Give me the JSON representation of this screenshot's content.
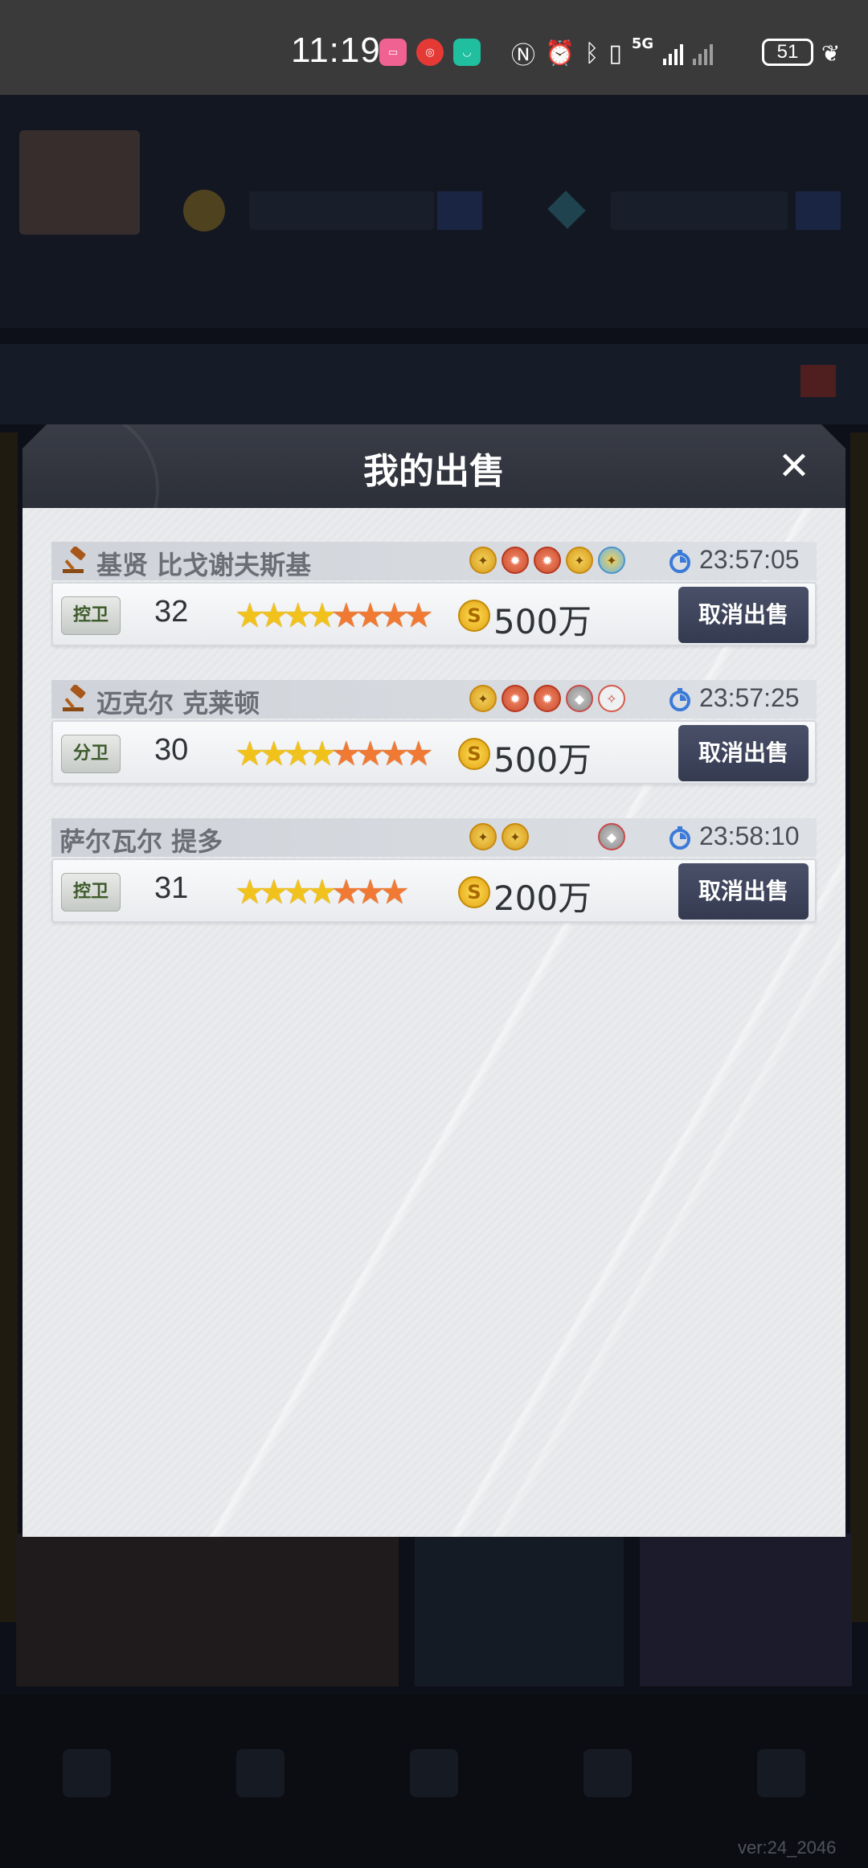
{
  "status_bar": {
    "time": "11:19",
    "battery": "51",
    "network": "5G",
    "icons": [
      "bilibili-icon",
      "app-red-icon",
      "app-green-icon",
      "nfc-icon",
      "alarm-icon",
      "bluetooth-icon",
      "vibrate-icon",
      "signal-icon",
      "battery-icon",
      "leaf-icon"
    ]
  },
  "modal": {
    "title": "我的出售",
    "close_icon": "close-icon"
  },
  "listings": [
    {
      "name": "基贤 比戈谢夫斯基",
      "auction": true,
      "time_left": "23:57:05",
      "position": "控卫",
      "rating": "32",
      "stars_yellow": 4,
      "stars_orange": 4,
      "price": "500万",
      "cancel_label": "取消出售",
      "badges": [
        "gold",
        "red",
        "red",
        "gold",
        "blue"
      ]
    },
    {
      "name": "迈克尔 克莱顿",
      "auction": true,
      "time_left": "23:57:25",
      "position": "分卫",
      "rating": "30",
      "stars_yellow": 4,
      "stars_orange": 4,
      "price": "500万",
      "cancel_label": "取消出售",
      "badges": [
        "gold",
        "red",
        "red",
        "grey",
        "outline"
      ]
    },
    {
      "name": "萨尔瓦尔 提多",
      "auction": false,
      "time_left": "23:58:10",
      "position": "控卫",
      "rating": "31",
      "stars_yellow": 4,
      "stars_orange": 3,
      "price": "200万",
      "cancel_label": "取消出售",
      "badges": [
        "gold",
        "gold",
        "spacer",
        "spacer",
        "grey"
      ]
    }
  ],
  "footer": {
    "version": "ver:24_2046"
  },
  "colors": {
    "modal_header": "#2f323b",
    "cancel_button": "#3d4359",
    "star_yellow": "#f2c21c",
    "star_orange": "#f07a34",
    "coin": "#f2c21c"
  }
}
